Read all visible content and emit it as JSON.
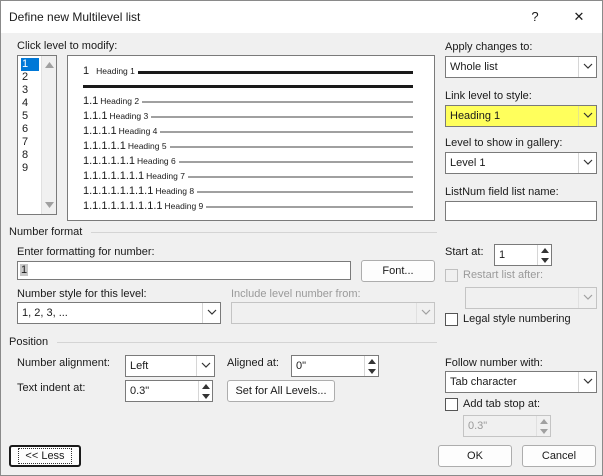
{
  "window": {
    "title": "Define new Multilevel list",
    "help_glyph": "?",
    "close_glyph": "✕"
  },
  "levels": {
    "label": "Click level to modify:",
    "items": [
      "1",
      "2",
      "3",
      "4",
      "5",
      "6",
      "7",
      "8",
      "9"
    ],
    "selected": "1"
  },
  "preview": {
    "rows": [
      {
        "number": "1",
        "heading": "Heading 1"
      },
      {
        "number": "1.1",
        "heading": "Heading 2"
      },
      {
        "number": "1.1.1",
        "heading": "Heading 3"
      },
      {
        "number": "1.1.1.1",
        "heading": "Heading 4"
      },
      {
        "number": "1.1.1.1.1",
        "heading": "Heading 5"
      },
      {
        "number": "1.1.1.1.1.1",
        "heading": "Heading 6"
      },
      {
        "number": "1.1.1.1.1.1.1",
        "heading": "Heading 7"
      },
      {
        "number": "1.1.1.1.1.1.1.1",
        "heading": "Heading 8"
      },
      {
        "number": "1.1.1.1.1.1.1.1.1",
        "heading": "Heading 9"
      }
    ]
  },
  "apply_changes": {
    "label": "Apply changes to:",
    "value": "Whole list"
  },
  "link_level": {
    "label": "Link level to style:",
    "value": "Heading 1",
    "highlight_color": "#ffff5c"
  },
  "gallery_level": {
    "label": "Level to show in gallery:",
    "value": "Level 1"
  },
  "listnum": {
    "label": "ListNum field list name:",
    "value": ""
  },
  "number_format": {
    "section_label": "Number format",
    "enter_label": "Enter formatting for number:",
    "format_value": "1",
    "font_button": "Font...",
    "style_label": "Number style for this level:",
    "style_value": "1, 2, 3, ...",
    "include_label": "Include level number from:",
    "include_value": "",
    "start_at_label": "Start at:",
    "start_at_value": "1",
    "restart_label": "Restart list after:",
    "restart_value": "",
    "legal_label": "Legal style numbering"
  },
  "position": {
    "section_label": "Position",
    "alignment_label": "Number alignment:",
    "alignment_value": "Left",
    "aligned_at_label": "Aligned at:",
    "aligned_at_value": "0\"",
    "indent_label": "Text indent at:",
    "indent_value": "0.3\"",
    "set_all_button": "Set for All Levels...",
    "follow_label": "Follow number with:",
    "follow_value": "Tab character",
    "add_tab_label": "Add tab stop at:",
    "add_tab_value": "0.3\""
  },
  "footer": {
    "less_button": "<< Less",
    "ok_button": "OK",
    "cancel_button": "Cancel"
  }
}
